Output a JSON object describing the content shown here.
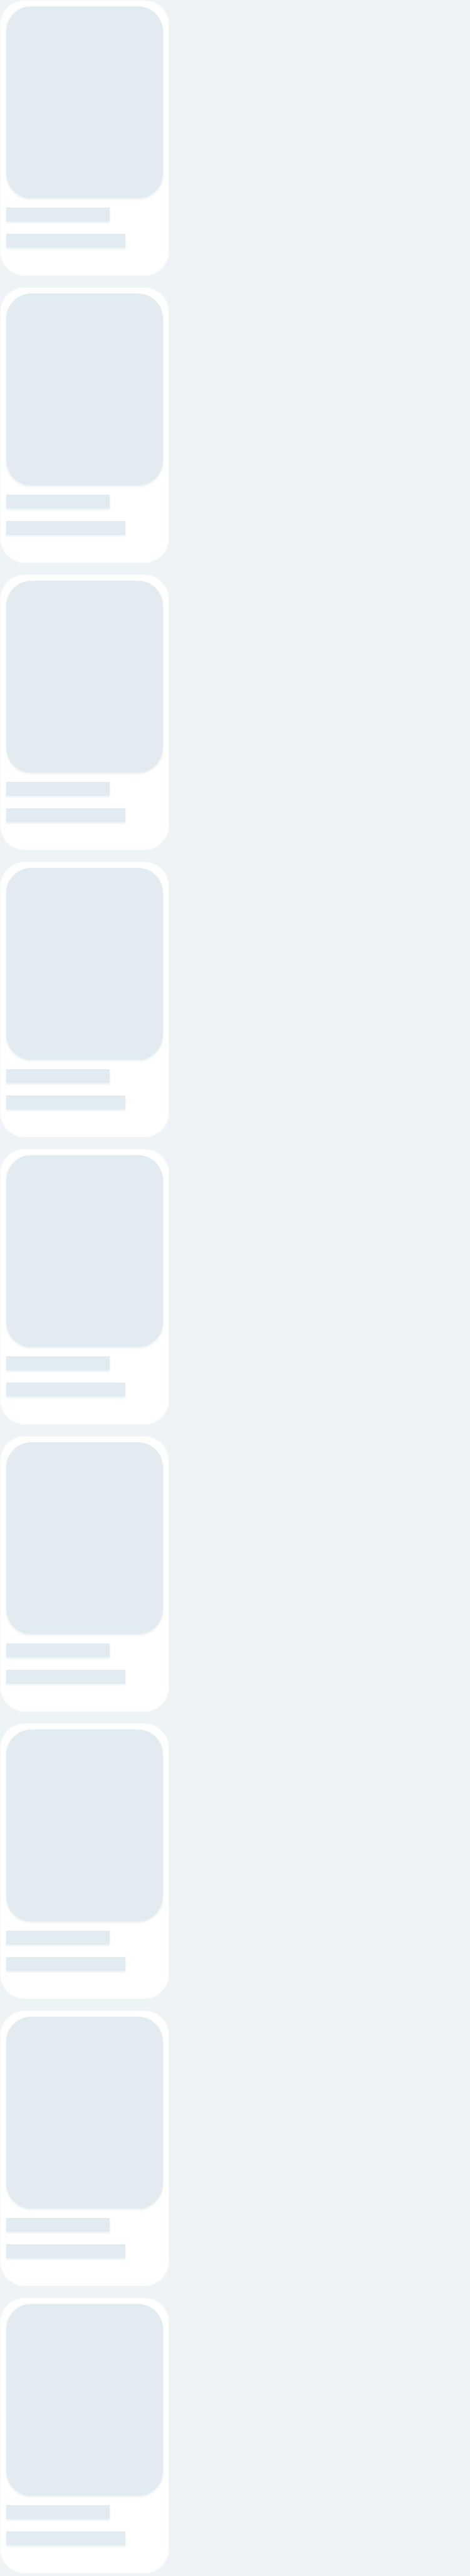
{
  "feed": {
    "cards": [
      {
        "state": "loading-placeholder"
      },
      {
        "state": "loading-placeholder"
      },
      {
        "state": "loading-placeholder"
      },
      {
        "state": "loading-placeholder"
      },
      {
        "state": "loading-placeholder"
      },
      {
        "state": "loading-placeholder"
      },
      {
        "state": "loading-placeholder"
      },
      {
        "state": "loading-placeholder"
      },
      {
        "state": "loading-placeholder"
      }
    ]
  },
  "colors": {
    "page_background": "#eef3f6",
    "card_background": "#ffffff",
    "placeholder": "#e2ecf0"
  }
}
